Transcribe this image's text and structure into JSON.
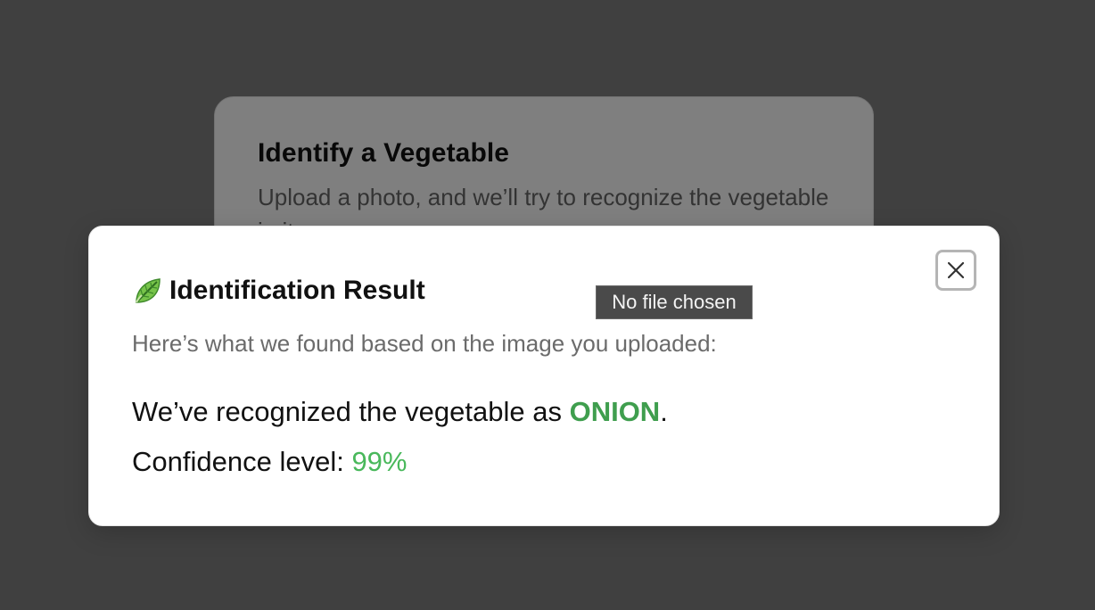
{
  "background_card": {
    "title": "Identify a Vegetable",
    "description": "Upload a photo, and we’ll try to recognize the vegetable in it."
  },
  "modal": {
    "icon": "leafy-green-icon",
    "title": "Identification Result",
    "subtitle": "Here’s what we found based on the image you uploaded:",
    "result_prefix": "We’ve recognized the vegetable as ",
    "vegetable_name": "ONION",
    "result_suffix": ".",
    "confidence_label": "Confidence level: ",
    "confidence_value": "99%",
    "close_icon": "close-icon"
  },
  "tooltip": {
    "text": "No file chosen"
  },
  "colors": {
    "vegetable_name": "#3f9e4e",
    "confidence_value": "#49b85b",
    "overlay": "#808080"
  }
}
